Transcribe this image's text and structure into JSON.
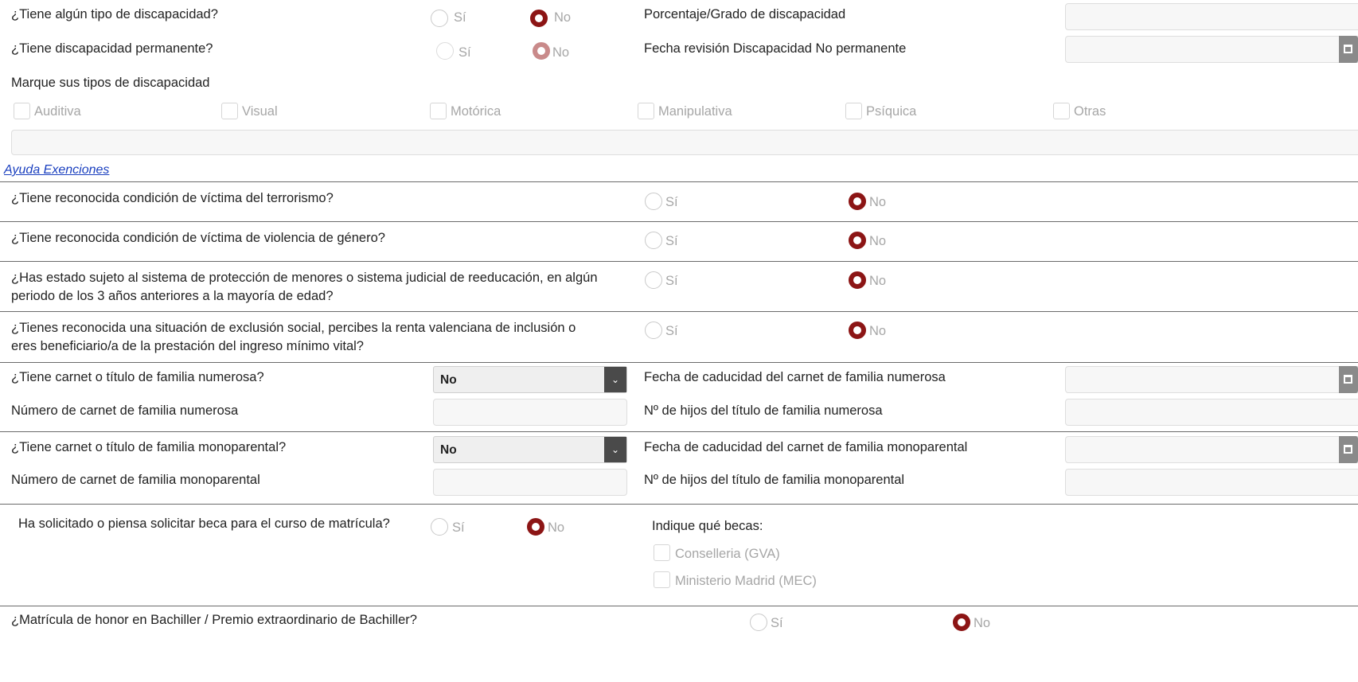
{
  "options": {
    "si": "Sí",
    "no": "No"
  },
  "discapacidad": {
    "q_tiene": "¿Tiene algún tipo de discapacidad?",
    "q_permanente": "¿Tiene discapacidad permanente?",
    "porcentaje_label": "Porcentaje/Grado de discapacidad",
    "fecha_revision_label": "Fecha revisión Discapacidad No permanente",
    "tipos_label": "Marque sus tipos de discapacidad",
    "tipos": [
      "Auditiva",
      "Visual",
      "Motórica",
      "Manipulativa",
      "Psíquica",
      "Otras"
    ]
  },
  "ayuda_link": "Ayuda Exenciones",
  "exenciones": [
    {
      "question": "¿Tiene reconocida condición de víctima del terrorismo?",
      "selected": "No"
    },
    {
      "question": "¿Tiene reconocida condición de víctima de violencia de género?",
      "selected": "No"
    },
    {
      "question": "¿Has estado sujeto al sistema de protección de menores o sistema judicial de reeducación, en algún periodo de los 3 años anteriores a la mayoría de edad?",
      "selected": "No"
    },
    {
      "question": "¿Tienes reconocida una situación de exclusión social, percibes la renta valenciana de inclusión o eres beneficiario/a de la prestación del ingreso mínimo vital?",
      "selected": "No"
    }
  ],
  "numerosa": {
    "q": "¿Tiene carnet o título de familia numerosa?",
    "select_value": "No",
    "fecha_label": "Fecha de caducidad del carnet de familia numerosa",
    "numero_label": "Número de carnet de familia numerosa",
    "hijos_label": "Nº de hijos del título de familia numerosa"
  },
  "monoparental": {
    "q": "¿Tiene carnet o título de familia monoparental?",
    "select_value": "No",
    "fecha_label": "Fecha de caducidad del carnet de familia monoparental",
    "numero_label": "Número de carnet de familia monoparental",
    "hijos_label": "Nº de hijos del título de familia monoparental"
  },
  "beca": {
    "q": "Ha solicitado o piensa solicitar beca para el curso de matrícula?",
    "indique_label": "Indique qué becas:",
    "becas": [
      "Conselleria (GVA)",
      "Ministerio Madrid (MEC)"
    ]
  },
  "matricula_honor": {
    "q": "¿Matrícula de honor en Bachiller / Premio extraordinario de Bachiller?"
  },
  "colors": {
    "accent": "#8c1515",
    "link": "#1a3fbf"
  }
}
